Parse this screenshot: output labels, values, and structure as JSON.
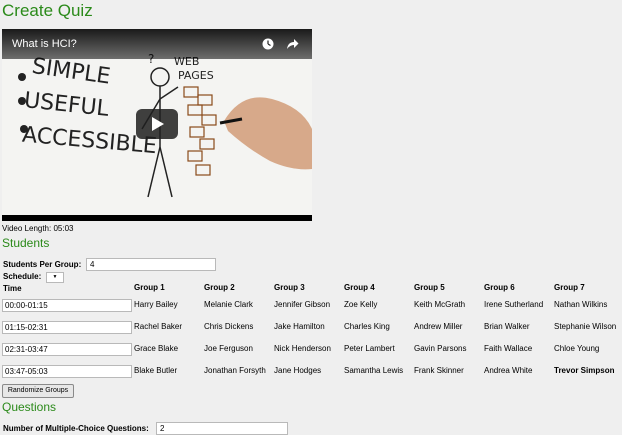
{
  "page": {
    "title": "Create Quiz"
  },
  "video": {
    "title": "What is HCI?",
    "length_label": "Video Length: 05:03",
    "icons": [
      "clock-icon",
      "share-icon",
      "play-icon"
    ]
  },
  "students": {
    "section_title": "Students",
    "per_group_label": "Students Per Group:",
    "per_group_value": "4",
    "schedule_label": "Schedule:",
    "schedule_select": "▼",
    "time_header": "Time",
    "groups": [
      "Group 1",
      "Group 2",
      "Group 3",
      "Group 4",
      "Group 5",
      "Group 6",
      "Group 7"
    ],
    "rows": [
      {
        "time": "00:00-01:15",
        "members": [
          "Harry Bailey",
          "Melanie  Clark",
          "Jennifer Gibson",
          "Zoe  Kelly",
          "Keith  McGrath",
          "Irene Sutherland",
          "Nathan Wilkins"
        ]
      },
      {
        "time": "01:15-02:31",
        "members": [
          "Rachel Baker",
          "Chris  Dickens",
          "Jake Hamilton",
          "Charles  King",
          "Andrew Miller",
          "Brian Walker",
          "Stephanie Wilson"
        ]
      },
      {
        "time": "02:31-03:47",
        "members": [
          "Grace  Blake",
          "Joe  Ferguson",
          "Nick Henderson",
          "Peter  Lambert",
          "Gavin  Parsons",
          "Faith  Wallace",
          "Chloe  Young"
        ]
      },
      {
        "time": "03:47-05:03",
        "members": [
          "Blake  Butler",
          "Jonathan Forsyth",
          "Jane Hodges",
          "Samantha Lewis",
          "Frank  Skinner",
          "Andrea White",
          "Trevor Simpson"
        ]
      }
    ],
    "randomize_label": "Randomize Groups"
  },
  "questions": {
    "section_title": "Questions",
    "mc_label": "Number of Multiple-Choice Questions:",
    "mc_value": "2"
  },
  "colors": {
    "heading_green": "#2b8a1a",
    "page_bg": "#efefef"
  }
}
